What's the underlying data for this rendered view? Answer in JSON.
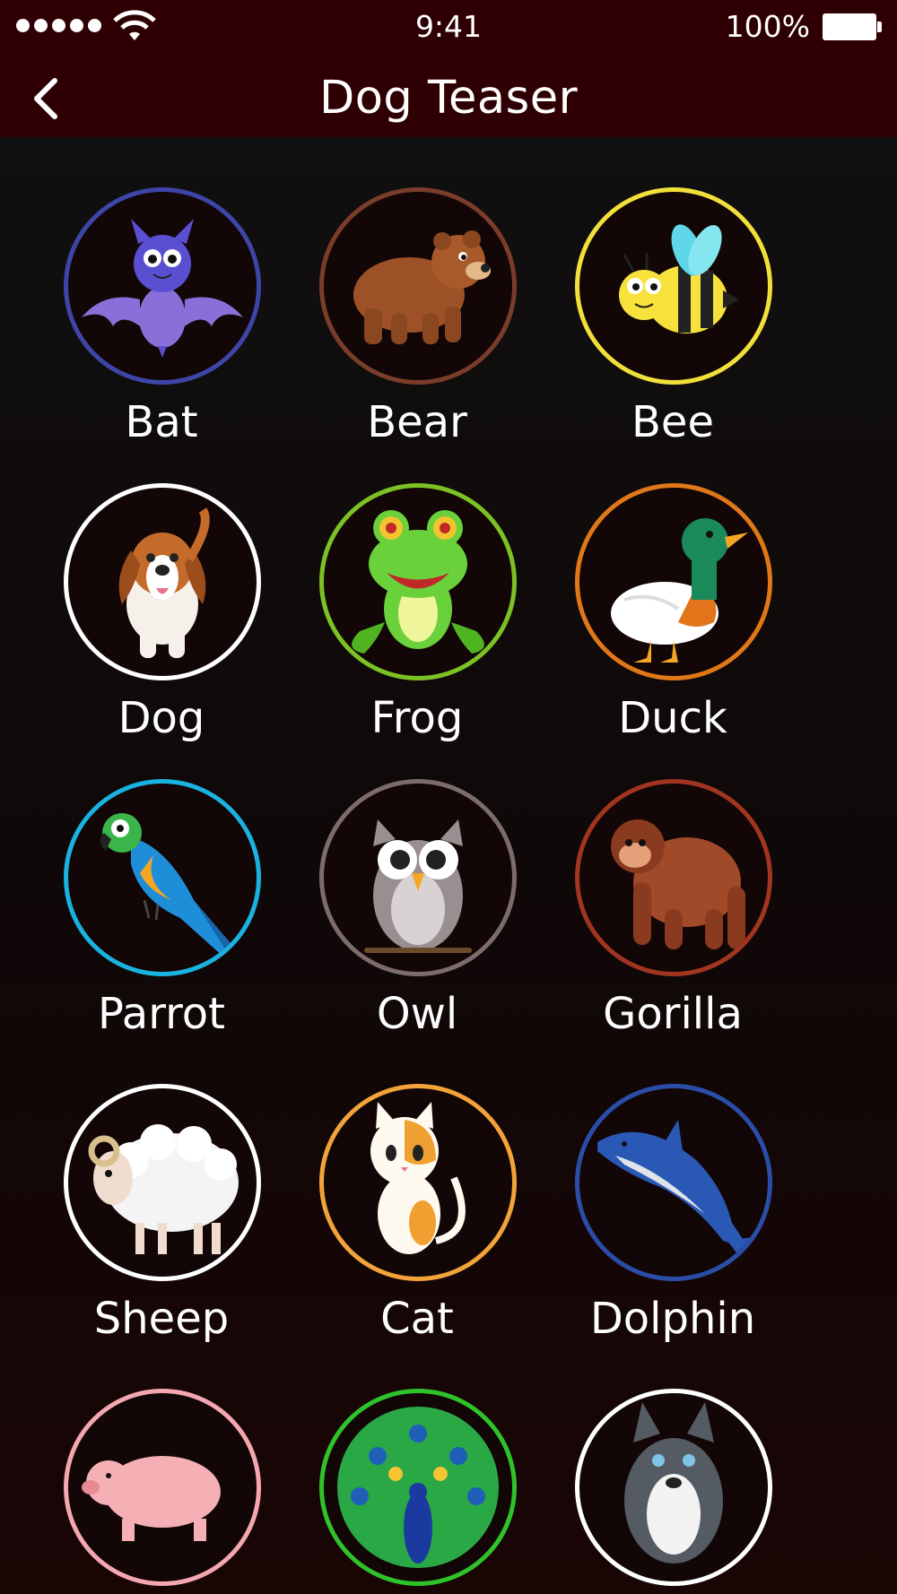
{
  "status_bar": {
    "time": "9:41",
    "battery": "100%"
  },
  "header": {
    "title": "Dog Teaser",
    "background": "#2f0003"
  },
  "animals": [
    {
      "name": "Bat",
      "ring_color": "#3d46a8",
      "icon": "bat-icon"
    },
    {
      "name": "Bear",
      "ring_color": "#7a3d2a",
      "icon": "bear-icon"
    },
    {
      "name": "Bee",
      "ring_color": "#f2e03a",
      "icon": "bee-icon"
    },
    {
      "name": "Dog",
      "ring_color": "#ffffff",
      "icon": "dog-icon"
    },
    {
      "name": "Frog",
      "ring_color": "#7cc225",
      "icon": "frog-icon"
    },
    {
      "name": "Duck",
      "ring_color": "#e07818",
      "icon": "duck-icon"
    },
    {
      "name": "Parrot",
      "ring_color": "#1ab2e0",
      "icon": "parrot-icon"
    },
    {
      "name": "Owl",
      "ring_color": "#7d6c6c",
      "icon": "owl-icon"
    },
    {
      "name": "Gorilla",
      "ring_color": "#a2351f",
      "icon": "gorilla-icon"
    },
    {
      "name": "Sheep",
      "ring_color": "#ffffff",
      "icon": "sheep-icon"
    },
    {
      "name": "Cat",
      "ring_color": "#f2a33a",
      "icon": "cat-icon"
    },
    {
      "name": "Dolphin",
      "ring_color": "#2a4ea8",
      "icon": "dolphin-icon"
    },
    {
      "name": "",
      "ring_color": "#f4a7b0",
      "icon": "pig-icon"
    },
    {
      "name": "",
      "ring_color": "#2ec22b",
      "icon": "peacock-icon"
    },
    {
      "name": "",
      "ring_color": "#ffffff",
      "icon": "husky-icon"
    }
  ]
}
